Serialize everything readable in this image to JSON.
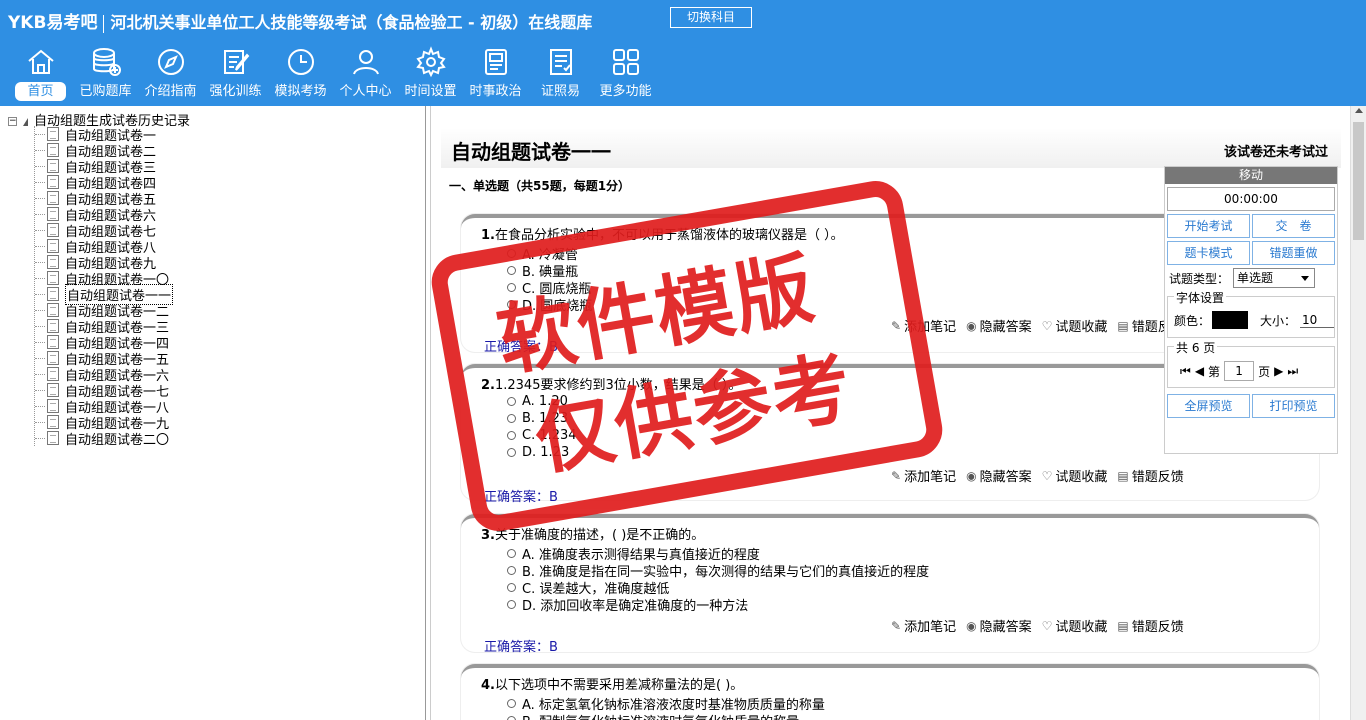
{
  "header": {
    "logo": "YKB易考吧",
    "title": "河北机关事业单位工人技能等级考试（食品检验工 - 初级）在线题库",
    "switch_subject": "切换科目"
  },
  "nav": [
    {
      "label": "首页",
      "icon": "home-icon"
    },
    {
      "label": "已购题库",
      "icon": "database-icon"
    },
    {
      "label": "介绍指南",
      "icon": "compass-icon"
    },
    {
      "label": "强化训练",
      "icon": "edit-icon"
    },
    {
      "label": "模拟考场",
      "icon": "clock-icon"
    },
    {
      "label": "个人中心",
      "icon": "user-icon"
    },
    {
      "label": "时间设置",
      "icon": "gear-icon"
    },
    {
      "label": "时事政治",
      "icon": "news-icon"
    },
    {
      "label": "证照易",
      "icon": "certificate-icon"
    },
    {
      "label": "更多功能",
      "icon": "grid-icon"
    }
  ],
  "tree": {
    "root": "自动组题生成试卷历史记录",
    "items": [
      "自动组题试卷一",
      "自动组题试卷二",
      "自动组题试卷三",
      "自动组题试卷四",
      "自动组题试卷五",
      "自动组题试卷六",
      "自动组题试卷七",
      "自动组题试卷八",
      "自动组题试卷九",
      "自动组题试卷一〇",
      "自动组题试卷一一",
      "自动组题试卷一二",
      "自动组题试卷一三",
      "自动组题试卷一四",
      "自动组题试卷一五",
      "自动组题试卷一六",
      "自动组题试卷一七",
      "自动组题试卷一八",
      "自动组题试卷一九",
      "自动组题试卷二〇"
    ]
  },
  "exam": {
    "title": "自动组题试卷一一",
    "status": "该试卷还未考试过",
    "section": "一、单选题（共55题，每题1分）",
    "actions": {
      "note": "添加笔记",
      "hide": "隐藏答案",
      "fav": "试题收藏",
      "report": "错题反馈"
    },
    "answer_label": "正确答案：",
    "questions": [
      {
        "num": "1.",
        "text": "在食品分析实验中，不可以用于蒸馏液体的玻璃仪器是（ ）。",
        "options": [
          "A. 冷凝管",
          "B. 碘量瓶",
          "C. 圆底烧瓶",
          "D. 圆底烧瓶"
        ],
        "answer": "B"
      },
      {
        "num": "2.",
        "text": "1.2345要求修约到3位小数，结果是（ ）。",
        "options": [
          "A. 1.20",
          "B. 1.23",
          "C. 1.234",
          "D. 1.23"
        ],
        "answer": "B"
      },
      {
        "num": "3.",
        "text": "关于准确度的描述，( )是不正确的。",
        "options": [
          "A. 准确度表示测得结果与真值接近的程度",
          "B. 准确度是指在同一实验中，每次测得的结果与它们的真值接近的程度",
          "C. 误差越大，准确度越低",
          "D. 添加回收率是确定准确度的一种方法"
        ],
        "answer": "B"
      },
      {
        "num": "4.",
        "text": "以下选项中不需要采用差减称量法的是( )。",
        "options": [
          "A. 标定氢氧化钠标准溶液浓度时基准物质质量的称量",
          "B. 配制氢氧化钠标准溶液时氢氧化钠质量的称量"
        ],
        "answer": ""
      }
    ]
  },
  "tool": {
    "move": "移动",
    "timer": "00:00:00",
    "start": "开始考试",
    "submit": "交　卷",
    "card_mode": "题卡模式",
    "redo": "错题重做",
    "type_label": "试题类型：",
    "type_value": "单选题",
    "font_legend": "字体设置",
    "color_label": "颜色：",
    "size_label": "大小：",
    "size_value": "10",
    "pages_legend": "共 6 页",
    "page_prefix": "第",
    "page_value": "1",
    "page_suffix": "页",
    "fullscreen": "全屏预览",
    "print": "打印预览"
  },
  "watermark": {
    "line1": "软件模版",
    "line2": "仅供参考"
  }
}
